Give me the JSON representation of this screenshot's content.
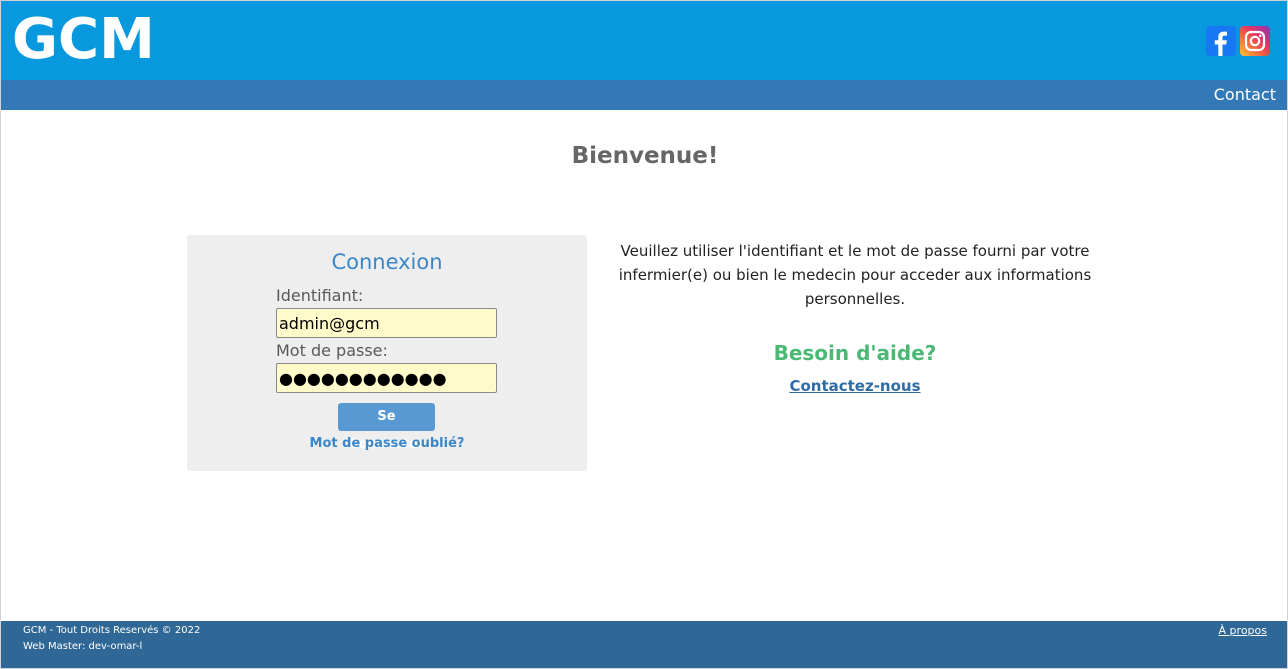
{
  "header": {
    "logo": "GCM",
    "social": [
      {
        "icon": "facebook-icon",
        "color": "#1877f2"
      },
      {
        "icon": "instagram-icon",
        "color": "#e1306c"
      }
    ],
    "background": "#0798de"
  },
  "nav": {
    "contact_label": "Contact",
    "background": "#3379b7"
  },
  "main": {
    "welcome": "Bienvenue!"
  },
  "login": {
    "title": "Connexion",
    "username_label": "Identifiant:",
    "username_value": "admin@gcm",
    "password_label": "Mot de passe:",
    "password_value": "●●●●●●●●●●●●",
    "submit_label": "Se Connecter",
    "forgot_label": "Mot de passe oublié?"
  },
  "info": {
    "text": "Veuillez utiliser l'identifiant et le mot de passe fourni par votre infermier(e) ou bien le medecin pour acceder aux informations personnelles.",
    "help_title": "Besoin d'aide?",
    "help_link": "Contactez-nous",
    "help_color": "#4bb875"
  },
  "footer": {
    "copyright": "GCM - Tout Droits Reservés © 2022",
    "webmaster": "Web Master: dev-omar-l",
    "about_label": "À propos",
    "background": "#2f6896"
  }
}
